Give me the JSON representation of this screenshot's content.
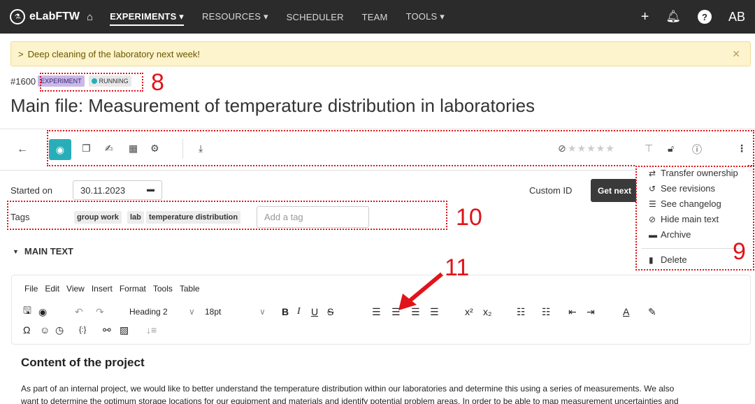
{
  "navbar": {
    "brand": "eLabFTW",
    "items": [
      {
        "label": "EXPERIMENTS ▾"
      },
      {
        "label": "RESOURCES ▾"
      },
      {
        "label": "SCHEDULER"
      },
      {
        "label": "TEAM"
      },
      {
        "label": "TOOLS ▾"
      }
    ],
    "user_initials": "AB"
  },
  "alert": {
    "message": "Deep cleaning of the laboratory next week!"
  },
  "entity": {
    "id": "#1600",
    "type_badge": "EXPERIMENT",
    "status_badge": "RUNNING",
    "status_color": "#29aeb9",
    "title": "Main file: Measurement of temperature distribution in laboratories"
  },
  "form": {
    "started_on_label": "Started on",
    "started_on_value": "30.11.2023",
    "custom_id_label": "Custom ID",
    "get_next_label": "Get next",
    "tags_label": "Tags",
    "tags": [
      "group work",
      "lab",
      "temperature distribution"
    ],
    "tag_placeholder": "Add a tag",
    "main_text_label": "MAIN TEXT"
  },
  "menu": {
    "items": [
      {
        "label": "Transfer ownership",
        "icon": "transfer-icon"
      },
      {
        "label": "See revisions",
        "icon": "history-icon"
      },
      {
        "label": "See changelog",
        "icon": "list-icon"
      },
      {
        "label": "Hide main text",
        "icon": "eye-slash-icon"
      },
      {
        "label": "Archive",
        "icon": "archive-icon"
      },
      {
        "label": "Delete",
        "icon": "trash-icon"
      }
    ]
  },
  "editor": {
    "menubar": [
      "File",
      "Edit",
      "View",
      "Insert",
      "Format",
      "Tools",
      "Table"
    ],
    "block_format": "Heading 2",
    "font_size": "18pt",
    "content_heading": "Content of the project",
    "content_line1": "As part of an internal project, we would like to better understand the temperature distribution within our laboratories and determine this using a series of measurements. We also",
    "content_line2": "want to determine the optimum storage locations for our equipment and materials and identify potential problem areas. In order to be able to map measurement uncertainties and"
  },
  "annotations": {
    "a8": "8",
    "a9": "9",
    "a10": "10",
    "a11": "11",
    "color": "#e0141a"
  }
}
